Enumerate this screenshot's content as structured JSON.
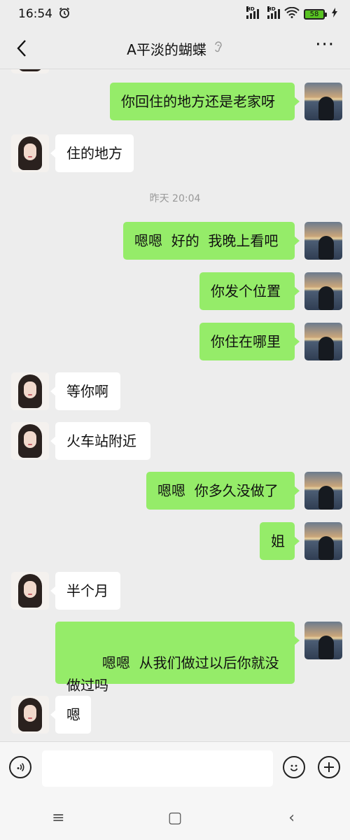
{
  "status_bar": {
    "time": "16:54",
    "alarm_icon": "alarm-icon",
    "signal_label_1": "HD",
    "signal_label_2": "HD",
    "battery": "58"
  },
  "header": {
    "title": "A平淡的蝴蝶",
    "back_icon": "chevron-left-icon",
    "ear_icon": "ear-icon",
    "more_label": "···"
  },
  "messages": [
    {
      "sender": "me",
      "text": "你回住的地方还是老家呀"
    },
    {
      "sender": "her",
      "text": "住的地方"
    },
    {
      "sender": "system",
      "text": "昨天 20:04"
    },
    {
      "sender": "me",
      "text": "嗯嗯  好的  我晚上看吧"
    },
    {
      "sender": "me",
      "text": "你发个位置"
    },
    {
      "sender": "me",
      "text": "你住在哪里"
    },
    {
      "sender": "her",
      "text": "等你啊"
    },
    {
      "sender": "her",
      "text": "火车站附近"
    },
    {
      "sender": "me",
      "text": "嗯嗯  你多久没做了"
    },
    {
      "sender": "me",
      "text": "姐"
    },
    {
      "sender": "her",
      "text": "半个月"
    },
    {
      "sender": "me",
      "text": "嗯嗯  从我们做过以后你就没做过吗"
    },
    {
      "sender": "her",
      "text": "嗯"
    }
  ],
  "input_bar": {
    "voice_icon": "voice-icon",
    "emoji_icon": "emoji-icon",
    "plus_icon": "plus-icon",
    "placeholder": ""
  },
  "nav_bar": {
    "menu_label": "≡",
    "home_label": "▢",
    "back_label": "‹"
  }
}
